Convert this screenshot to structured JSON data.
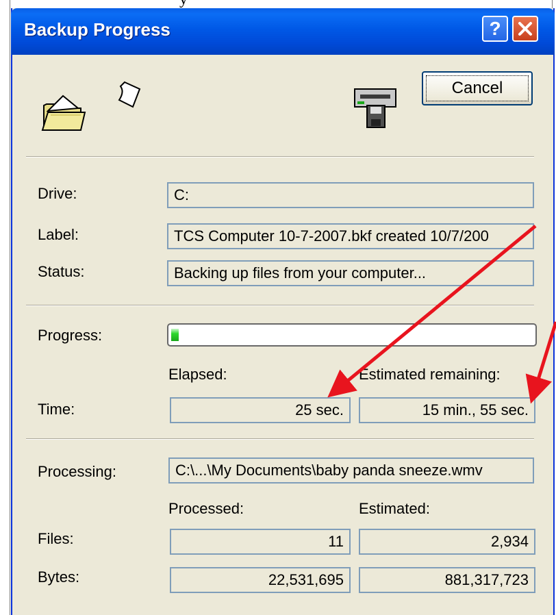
{
  "window": {
    "title": "Backup Progress"
  },
  "titlebar": {
    "help_label": "?"
  },
  "buttons": {
    "cancel_label": "Cancel"
  },
  "fields": {
    "drive": {
      "label": "Drive:",
      "value": "C:"
    },
    "label": {
      "label": "Label:",
      "value": "TCS Computer 10-7-2007.bkf created 10/7/200"
    },
    "status": {
      "label": "Status:",
      "value": "Backing up files from your computer..."
    }
  },
  "progress": {
    "label": "Progress:",
    "fraction": 0.02,
    "fill_color": "#2bd82b"
  },
  "time": {
    "label": "Time:",
    "elapsed_header": "Elapsed:",
    "remaining_header": "Estimated remaining:",
    "elapsed": "25 sec.",
    "remaining": "15 min., 55 sec."
  },
  "processing": {
    "label": "Processing:",
    "value": "C:\\...\\My Documents\\baby panda sneeze.wmv"
  },
  "counts": {
    "processed_header": "Processed:",
    "estimated_header": "Estimated:",
    "files_label": "Files:",
    "files_processed": "11",
    "files_estimated": "2,934",
    "bytes_label": "Bytes:",
    "bytes_processed": "22,531,695",
    "bytes_estimated": "881,317,723"
  },
  "icons": [
    "open-folder-icon",
    "flying-document-icon",
    "backup-drive-icon",
    "close-icon"
  ],
  "colors": {
    "titlebar": "#0058e6",
    "dialog_bg": "#ece9d8",
    "field_border": "#7f9db9",
    "annotation_arrow": "#e8141e"
  }
}
